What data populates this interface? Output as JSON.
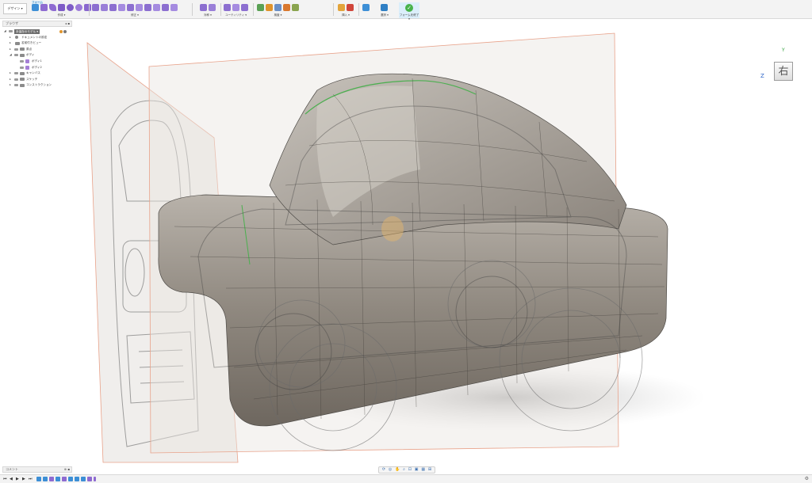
{
  "toolbar": {
    "workspace_label": "デザイン ▾",
    "mode_tab": "フォーム",
    "groups": {
      "create": "作成 ▾",
      "modify": "修正 ▾",
      "symmetry": "対称 ▾",
      "utilities": "ユーティリティ ▾",
      "inspect": "検査 ▾",
      "insert": "挿入 ▾",
      "select": "選択 ▾",
      "finish": "フォームを終了 ▾"
    }
  },
  "browser": {
    "title": "ブラウザ",
    "items": [
      {
        "label": "未保存のモデル ▾",
        "level": 0
      },
      {
        "label": "ドキュメントの設定",
        "level": 1
      },
      {
        "label": "名前付きビュー",
        "level": 1
      },
      {
        "label": "原点",
        "level": 1
      },
      {
        "label": "ボディ",
        "level": 1
      },
      {
        "label": "ボディ1",
        "level": 2
      },
      {
        "label": "ボディ2",
        "level": 2
      },
      {
        "label": "キャンバス",
        "level": 1
      },
      {
        "label": "スケッチ",
        "level": 1
      },
      {
        "label": "コンストラクション",
        "level": 1
      }
    ]
  },
  "comments": {
    "title": "コメント"
  },
  "viewcube": {
    "face_label": "右",
    "axis_y": "Y",
    "axis_z": "Z"
  },
  "colors": {
    "toolbar_bg": "#f3f3f3",
    "accent_blue": "#0696d7",
    "body_purple": "#a57fd6",
    "finish_green": "#47b24a",
    "sketch_plane_edge": "#e8a28a"
  }
}
